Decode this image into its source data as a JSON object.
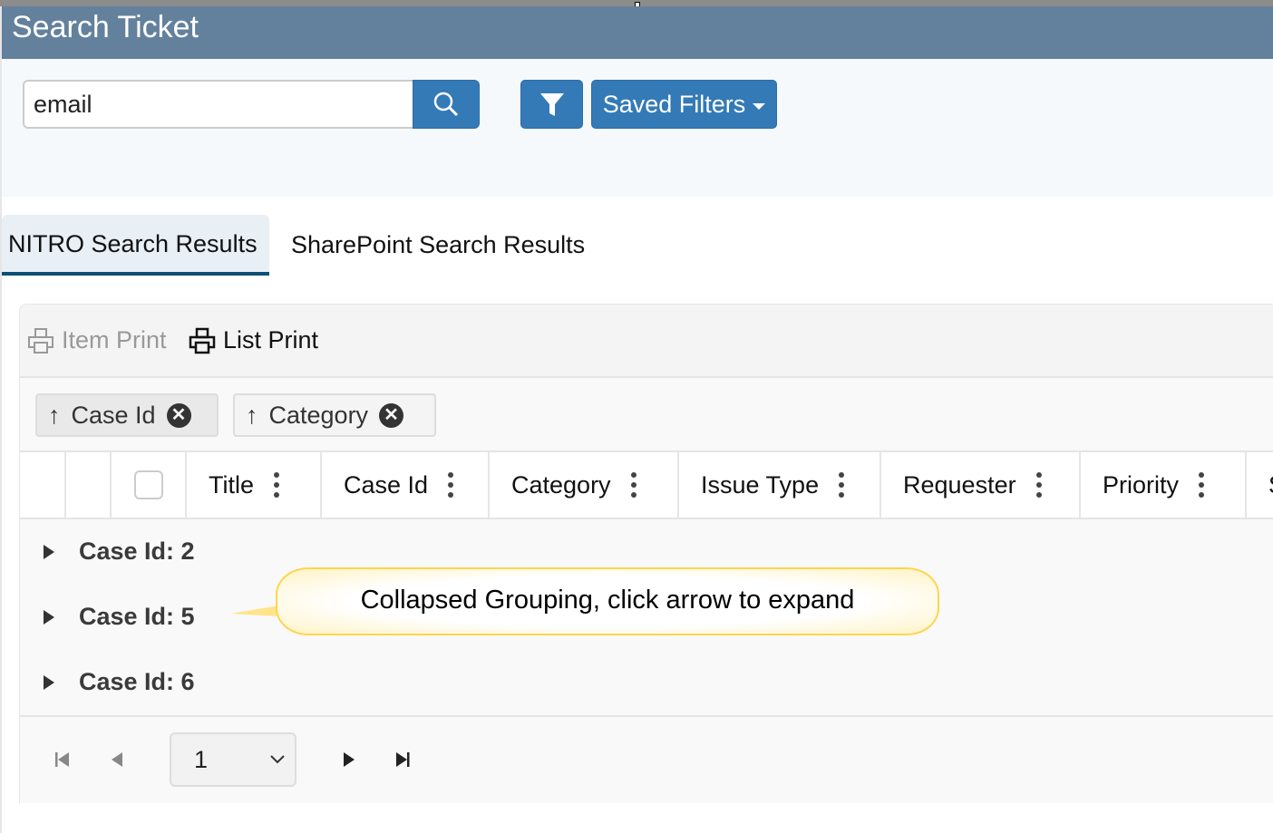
{
  "header": {
    "title": "Search Ticket"
  },
  "search": {
    "value": "email",
    "search_icon": "search-icon",
    "filter_icon": "filter-icon",
    "saved_filters_label": "Saved Filters"
  },
  "tabs": [
    {
      "label": "NITRO Search Results",
      "active": true
    },
    {
      "label": "SharePoint Search Results",
      "active": false
    }
  ],
  "toolbar": {
    "item_print": "Item Print",
    "list_print": "List Print"
  },
  "grouping": [
    {
      "label": "Case Id",
      "sort": "ascending"
    },
    {
      "label": "Category",
      "sort": "ascending"
    }
  ],
  "columns": [
    "Title",
    "Case Id",
    "Category",
    "Issue Type",
    "Requester",
    "Priority",
    "S"
  ],
  "groups": [
    "Case Id: 2",
    "Case Id: 5",
    "Case Id: 6"
  ],
  "pager": {
    "page": "1"
  },
  "callout": {
    "text": "Collapsed Grouping, click arrow to expand"
  },
  "colors": {
    "header": "#63819c",
    "button": "#337ab7",
    "tab_underline": "#0b4f76",
    "callout_border": "#ffd54f"
  }
}
